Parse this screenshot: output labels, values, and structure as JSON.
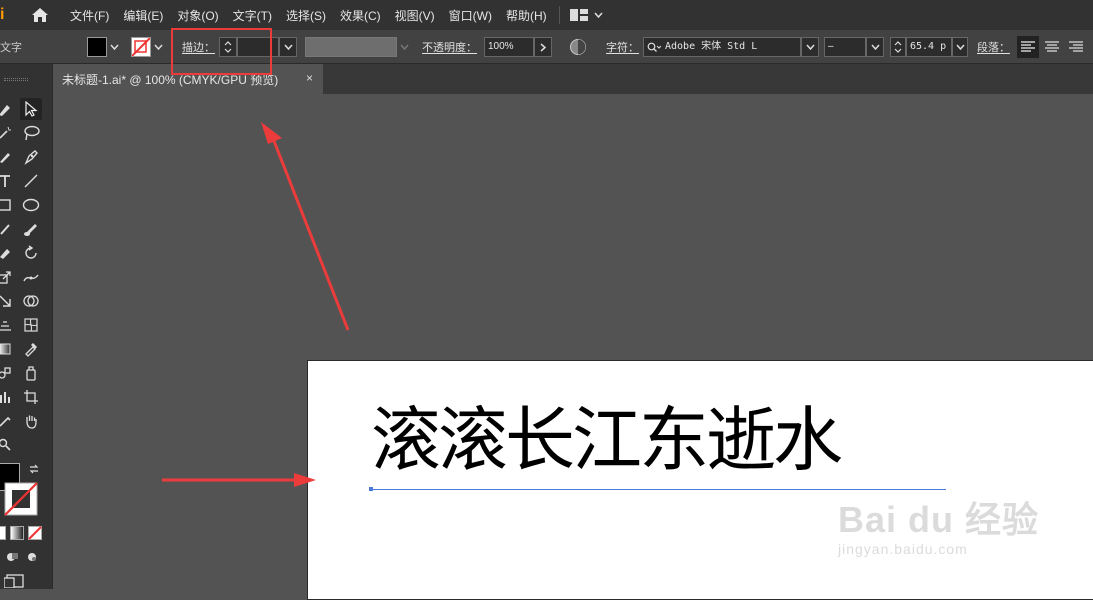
{
  "app": {
    "logo_char": "i",
    "accent_color": "#ff9a00"
  },
  "menu": {
    "items": [
      "文件(F)",
      "编辑(E)",
      "对象(O)",
      "文字(T)",
      "选择(S)",
      "效果(C)",
      "视图(V)",
      "窗口(W)",
      "帮助(H)"
    ]
  },
  "control_bar": {
    "tool_label": "文字",
    "stroke_label": "描边：",
    "opacity_label": "不透明度：",
    "opacity_value": "100%",
    "character_label": "字符：",
    "font_family": "Adobe 宋体 Std L",
    "font_style": "–",
    "font_size": "65.4 p",
    "paragraph_label": "段落：",
    "fill_color": "#000000",
    "highlight_color": "#ec3b3b"
  },
  "document": {
    "tab_title": "未标题-1.ai* @ 100% (CMYK/GPU 预览)",
    "close_glyph": "×"
  },
  "artboard": {
    "text": "滚滚长江东逝水"
  },
  "watermark": {
    "main": "Bai du 经验",
    "sub": "jingyan.baidu.com"
  },
  "annotations": {
    "arrow_color": "#ec3b3b"
  }
}
